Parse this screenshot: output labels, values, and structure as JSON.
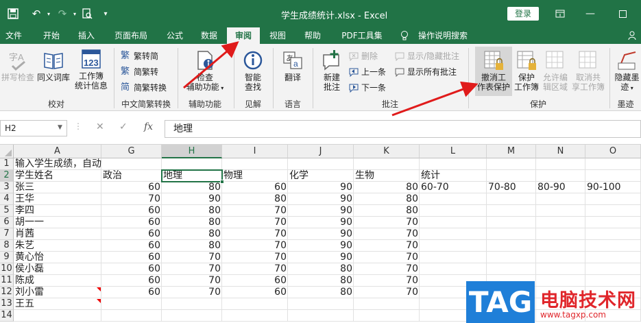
{
  "app": {
    "doc_title": "学生成绩统计.xlsx  -  Excel",
    "login_label": "登录",
    "colors": {
      "accent": "#217346",
      "arrow": "#e01b1b"
    }
  },
  "tabs": [
    {
      "label": "文件"
    },
    {
      "label": "开始"
    },
    {
      "label": "插入"
    },
    {
      "label": "页面布局"
    },
    {
      "label": "公式"
    },
    {
      "label": "数据"
    },
    {
      "label": "审阅"
    },
    {
      "label": "视图"
    },
    {
      "label": "帮助"
    },
    {
      "label": "PDF工具集"
    },
    {
      "label": "操作说明搜索"
    }
  ],
  "ribbon": {
    "proofing": {
      "label": "校对",
      "spelling": "拼写检查",
      "thesaurus": "同义词库",
      "stats_1": "工作簿",
      "stats_2": "统计信息"
    },
    "chinese": {
      "label": "中文简繁转换",
      "to_simplified": "繁转简",
      "to_traditional": "简繁转",
      "convert": "简繁转换"
    },
    "accessibility": {
      "label": "辅助功能",
      "check_1": "检查",
      "check_2": "辅助功能"
    },
    "insights": {
      "label": "见解",
      "smart_1": "智能",
      "smart_2": "查找"
    },
    "language": {
      "label": "语言",
      "translate": "翻译"
    },
    "comments": {
      "label": "批注",
      "new_1": "新建",
      "new_2": "批注",
      "delete": "删除",
      "prev": "上一条",
      "next": "下一条",
      "show_hide": "显示/隐藏批注",
      "show_all": "显示所有批注"
    },
    "protect": {
      "label": "保护",
      "unprotect_1": "撤消工",
      "unprotect_2": "作表保护",
      "protect_wb_1": "保护",
      "protect_wb_2": "工作簿",
      "allow_1": "允许编",
      "allow_2": "辑区域",
      "unshare_1": "取消共",
      "unshare_2": "享工作簿"
    },
    "ink": {
      "label": "墨迹",
      "hide_1": "隐藏墨",
      "hide_2": "迹"
    }
  },
  "formula_bar": {
    "name_box": "H2",
    "content": "地理"
  },
  "grid": {
    "columns": [
      "A",
      "G",
      "H",
      "I",
      "J",
      "K",
      "L",
      "M",
      "N",
      "O"
    ],
    "row_numbers": [
      "1",
      "2",
      "3",
      "4",
      "5",
      "6",
      "7",
      "8",
      "9",
      "10",
      "11",
      "12",
      "13",
      "14"
    ],
    "row1_text": "输入学生成绩，自动",
    "headers": [
      "学生姓名",
      "政治",
      "地理",
      "物理",
      "化学",
      "生物",
      "统计"
    ],
    "stats_ranges": [
      "60-70",
      "70-80",
      "80-90",
      "90-100"
    ],
    "rows": [
      {
        "name": "张三",
        "vals": [
          "60",
          "80",
          "60",
          "90",
          "80"
        ]
      },
      {
        "name": "王华",
        "vals": [
          "70",
          "90",
          "80",
          "90",
          "80"
        ]
      },
      {
        "name": "李四",
        "vals": [
          "60",
          "80",
          "70",
          "90",
          "80"
        ]
      },
      {
        "name": "胡一一",
        "vals": [
          "60",
          "80",
          "70",
          "90",
          "70"
        ]
      },
      {
        "name": "肖茜",
        "vals": [
          "60",
          "80",
          "70",
          "90",
          "70"
        ]
      },
      {
        "name": "朱艺",
        "vals": [
          "60",
          "80",
          "70",
          "90",
          "70"
        ]
      },
      {
        "name": "黄心怡",
        "vals": [
          "60",
          "70",
          "70",
          "90",
          "70"
        ]
      },
      {
        "name": "侯小磊",
        "vals": [
          "60",
          "70",
          "70",
          "80",
          "70"
        ]
      },
      {
        "name": "陈成",
        "vals": [
          "60",
          "70",
          "60",
          "80",
          "70"
        ]
      },
      {
        "name": "刘小雷",
        "vals": [
          "60",
          "70",
          "60",
          "80",
          "70"
        ]
      },
      {
        "name": "王五",
        "vals": [
          "",
          "",
          "",
          "",
          ""
        ]
      }
    ]
  },
  "watermark": {
    "logo": "TAG",
    "title": "电脑技术网",
    "url": "www.tagxp.com"
  }
}
